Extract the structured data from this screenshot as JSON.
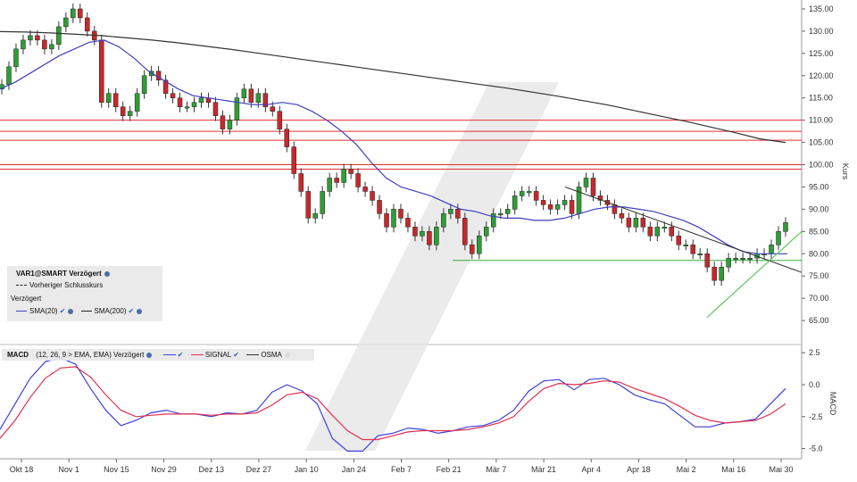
{
  "chart_data": [
    {
      "type": "candlestick",
      "ylabel": "Kurs",
      "ylim": [
        60,
        137
      ],
      "yticks": [
        65,
        70,
        75,
        80,
        85,
        90,
        95,
        100,
        105,
        110,
        115,
        120,
        125,
        130,
        135
      ],
      "ytick_labels": [
        "65.00",
        "70.00",
        "75.00",
        "80.00",
        "85.00",
        "90.00",
        "95.00",
        "100.00",
        "105.00",
        "110.00",
        "115.00",
        "120.00",
        "125.00",
        "130.00",
        "135.00"
      ],
      "xticks": [
        "Okt 18",
        "Nov 1",
        "Nov 15",
        "Nov 29",
        "Dez 13",
        "Dez 27",
        "Jan 10",
        "Jan 24",
        "Feb 7",
        "Feb 21",
        "Mär 7",
        "Mär 21",
        "Apr 4",
        "Apr 18",
        "Mai 2",
        "Mai 16",
        "Mai 30"
      ],
      "close": [
        118,
        122,
        126,
        128,
        129,
        128,
        126,
        127,
        131,
        133,
        135,
        133,
        130,
        128,
        114,
        116,
        113,
        111,
        112,
        116,
        120,
        121,
        119,
        116,
        115,
        113,
        113,
        114,
        115,
        114,
        111,
        108,
        110,
        115,
        117,
        114,
        116,
        113,
        112,
        108,
        104,
        98,
        94,
        88,
        89,
        94,
        97,
        96,
        99,
        98,
        95,
        94,
        92,
        89,
        86,
        90,
        88,
        86,
        84,
        85,
        82,
        86,
        89,
        90,
        88,
        82,
        80,
        84,
        86,
        89,
        89,
        90,
        93,
        94,
        94,
        92,
        91,
        90,
        91,
        92,
        89,
        95,
        97,
        93,
        92,
        91,
        89,
        88,
        86,
        88,
        86,
        84,
        86,
        86,
        84,
        82,
        82,
        80,
        80,
        77,
        74,
        77,
        79,
        79,
        79,
        79,
        80,
        80,
        82,
        85,
        87
      ],
      "upper_channel_lines": [
        110,
        107.5,
        105.5,
        100,
        99
      ],
      "support_line": 78.5,
      "sma200": [
        129.9,
        129.8,
        129.6,
        129.3,
        129,
        128.5,
        128,
        127.4,
        126.7,
        126,
        125.2,
        124.4,
        123.6,
        122.8,
        122,
        121.2,
        120.4,
        119.6,
        118.8,
        118,
        117.2,
        116.3,
        115.4,
        114.4,
        113.4,
        112.2,
        111,
        109.8,
        108.5,
        107.2,
        105.8,
        105
      ],
      "sma20": [
        117,
        118.5,
        120.5,
        122.5,
        124.5,
        126,
        127.5,
        128,
        126.5,
        124,
        121,
        119,
        117,
        115.5,
        115,
        114.5,
        114,
        113.5,
        113.5,
        114,
        113.5,
        112,
        110,
        107.5,
        104.5,
        100.5,
        97,
        95,
        94,
        93,
        91.5,
        90,
        89.5,
        88.5,
        88,
        88,
        87.5,
        87.5,
        88,
        89,
        90,
        90.5,
        90.5,
        90,
        89.5,
        88.5,
        87.5,
        86,
        84,
        82,
        80.5,
        80,
        80,
        80
      ],
      "legend": {
        "title": "VAR1@SMART Verzögert",
        "prev_close": "Vorheriger Schlusskurs",
        "delayed": "Verzögert",
        "sma20": "SMA(20)",
        "sma200": "SMA(200)"
      },
      "colors": {
        "up": "#2e9e35",
        "down": "#c8282b",
        "sma20": "#3f3fbf",
        "sma200": "#333333",
        "hline": "#e03030",
        "support": "#3aa83a",
        "trend": "#333333"
      }
    },
    {
      "type": "line",
      "ylabel": "MACD",
      "ylim": [
        -5.8,
        3.0
      ],
      "yticks": [
        2.5,
        0.0,
        -2.5,
        -5.0
      ],
      "ytick_labels": [
        "2.5",
        "0.0",
        "-2.5",
        "-5.0"
      ],
      "legend": {
        "title": "MACD",
        "params": "(12, 26, 9 > EMA, EMA) Verzögert",
        "signal": "SIGNAL",
        "osma": "OSMA"
      },
      "series": [
        {
          "name": "MACD",
          "color": "#3f3fdf",
          "values": [
            -3.5,
            -1.5,
            0.5,
            1.8,
            2.1,
            1.6,
            -0.3,
            -2,
            -3.2,
            -2.8,
            -2.2,
            -2,
            -2.3,
            -2.3,
            -2.5,
            -2.2,
            -2.3,
            -2.0,
            -0.6,
            0.0,
            -0.5,
            -1.5,
            -4.2,
            -5.2,
            -5.2,
            -4.0,
            -3.8,
            -3.4,
            -3.5,
            -3.8,
            -3.6,
            -3.3,
            -3.2,
            -2.8,
            -2.0,
            -0.5,
            0.3,
            0.4,
            -0.4,
            0.4,
            0.5,
            0.0,
            -0.8,
            -1.2,
            -1.5,
            -2.4,
            -3.3,
            -3.3,
            -3.0,
            -2.9,
            -2.7,
            -1.5,
            -0.3
          ]
        },
        {
          "name": "SIGNAL",
          "color": "#e03050",
          "values": [
            -4.2,
            -2.8,
            -1,
            0.5,
            1.3,
            1.4,
            0.6,
            -0.8,
            -2,
            -2.5,
            -2.4,
            -2.3,
            -2.3,
            -2.3,
            -2.4,
            -2.3,
            -2.3,
            -2.2,
            -1.6,
            -0.8,
            -0.6,
            -1.1,
            -2.4,
            -3.6,
            -4.3,
            -4.3,
            -4.0,
            -3.7,
            -3.6,
            -3.6,
            -3.6,
            -3.5,
            -3.3,
            -3.0,
            -2.5,
            -1.3,
            -0.3,
            0.1,
            0.0,
            0.1,
            0.3,
            0.2,
            -0.3,
            -0.7,
            -1.1,
            -1.7,
            -2.4,
            -2.8,
            -3.0,
            -2.9,
            -2.8,
            -2.3,
            -1.5
          ]
        }
      ]
    }
  ]
}
